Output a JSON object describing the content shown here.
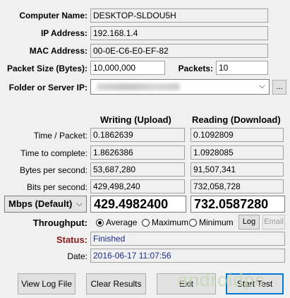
{
  "info": {
    "computer_name_label": "Computer Name:",
    "computer_name_value": "DESKTOP-SLDOU5H",
    "ip_label": "IP Address:",
    "ip_value": "192.168.1.4",
    "mac_label": "MAC Address:",
    "mac_value": "00-0E-C6-E0-EF-82",
    "packet_size_label": "Packet Size (Bytes):",
    "packet_size_value": "10,000,000",
    "packets_label": "Packets:",
    "packets_value": "10",
    "folder_label": "Folder or Server IP:",
    "browse_label": "..."
  },
  "results": {
    "writing_header": "Writing (Upload)",
    "reading_header": "Reading (Download)",
    "rows": [
      {
        "label": "Time / Packet:",
        "write": "0.1862639",
        "read": "0.1092809"
      },
      {
        "label": "Time to complete:",
        "write": "1.8626386",
        "read": "1.0928085"
      },
      {
        "label": "Bytes per second:",
        "write": "53,687,280",
        "read": "91,507,341"
      },
      {
        "label": "Bits per second:",
        "write": "429,498,240",
        "read": "732,058,728"
      }
    ],
    "unit_select": "Mbps (Default)",
    "mbps_write": "429.4982400",
    "mbps_read": "732.0587280"
  },
  "throughput": {
    "label": "Throughput:",
    "options": [
      "Average",
      "Maximum",
      "Minimum"
    ],
    "selected": "Average",
    "log_label": "Log",
    "email_label": "Email"
  },
  "status": {
    "label": "Status:",
    "value": "Finished",
    "date_label": "Date:",
    "date_value": "2016-06-17 11:07:56",
    "label_color": "#8b1a1a"
  },
  "buttons": {
    "view_log": "View Log File",
    "clear": "Clear Results",
    "exit": "Exit",
    "start": "Start Test"
  },
  "watermark": "androidpc"
}
